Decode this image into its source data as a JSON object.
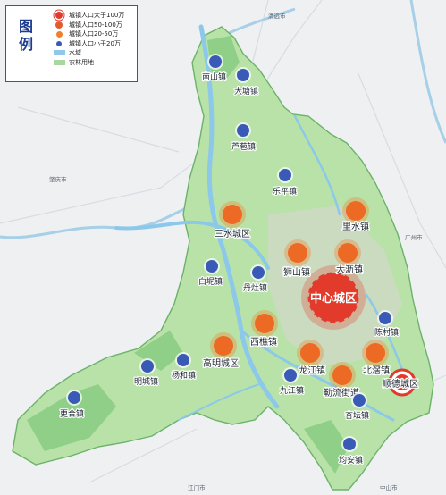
{
  "legend": {
    "title": "图例",
    "items": [
      {
        "label": "城镇人口大于100万",
        "color": "#e23a2b",
        "kind": "circle-ring"
      },
      {
        "label": "城镇人口50-100万",
        "color": "#e45a30",
        "kind": "circle"
      },
      {
        "label": "城镇人口20-50万",
        "color": "#f0802a",
        "kind": "circle"
      },
      {
        "label": "城镇人口小于20万",
        "color": "#3a5ab8",
        "kind": "circle"
      },
      {
        "label": "水域",
        "color": "#8fc8e8",
        "kind": "rect"
      },
      {
        "label": "农林用地",
        "color": "#a8d8a0",
        "kind": "rect"
      }
    ]
  },
  "center": {
    "label": "中心城区",
    "color": "#e23a2b"
  },
  "shunde": {
    "label": "顺德城区",
    "color": "#e23a2b"
  },
  "orange_towns": [
    {
      "id": "sanshui",
      "label": "三水城区"
    },
    {
      "id": "lishui",
      "label": "里水镇"
    },
    {
      "id": "shishan",
      "label": "狮山镇"
    },
    {
      "id": "dali",
      "label": "大沥镇"
    },
    {
      "id": "xiqiao",
      "label": "西樵镇"
    },
    {
      "id": "gaoming",
      "label": "高明城区"
    },
    {
      "id": "longjiang",
      "label": "龙江镇"
    },
    {
      "id": "beijiao",
      "label": "北滘镇"
    },
    {
      "id": "leliu",
      "label": "勒流街道"
    }
  ],
  "blue_towns": [
    {
      "id": "nanshan",
      "label": "南山镇"
    },
    {
      "id": "datang",
      "label": "大塘镇"
    },
    {
      "id": "lubao",
      "label": "芦苞镇"
    },
    {
      "id": "leping",
      "label": "乐平镇"
    },
    {
      "id": "baini",
      "label": "白坭镇"
    },
    {
      "id": "danzao",
      "label": "丹灶镇"
    },
    {
      "id": "chencun",
      "label": "陈村镇"
    },
    {
      "id": "yanghe",
      "label": "杨和镇"
    },
    {
      "id": "mingcheng",
      "label": "明城镇"
    },
    {
      "id": "jiujiang",
      "label": "九江镇"
    },
    {
      "id": "xingtan",
      "label": "杏坛镇"
    },
    {
      "id": "genghe",
      "label": "更合镇"
    },
    {
      "id": "jun_an",
      "label": "均安镇"
    }
  ],
  "cities": [
    {
      "id": "qingyuan",
      "label": "清远市"
    },
    {
      "id": "zhaoqing",
      "label": "肇庆市"
    },
    {
      "id": "guangzhou",
      "label": "广州市"
    },
    {
      "id": "jiangmen",
      "label": "江门市"
    },
    {
      "id": "zhongshan",
      "label": "中山市"
    }
  ],
  "colors": {
    "land": "#b8e2a8",
    "land_dark": "#8ccd84",
    "water": "#8cc8ea",
    "outside": "#eef0f2",
    "boundary": "#5fae5a"
  }
}
